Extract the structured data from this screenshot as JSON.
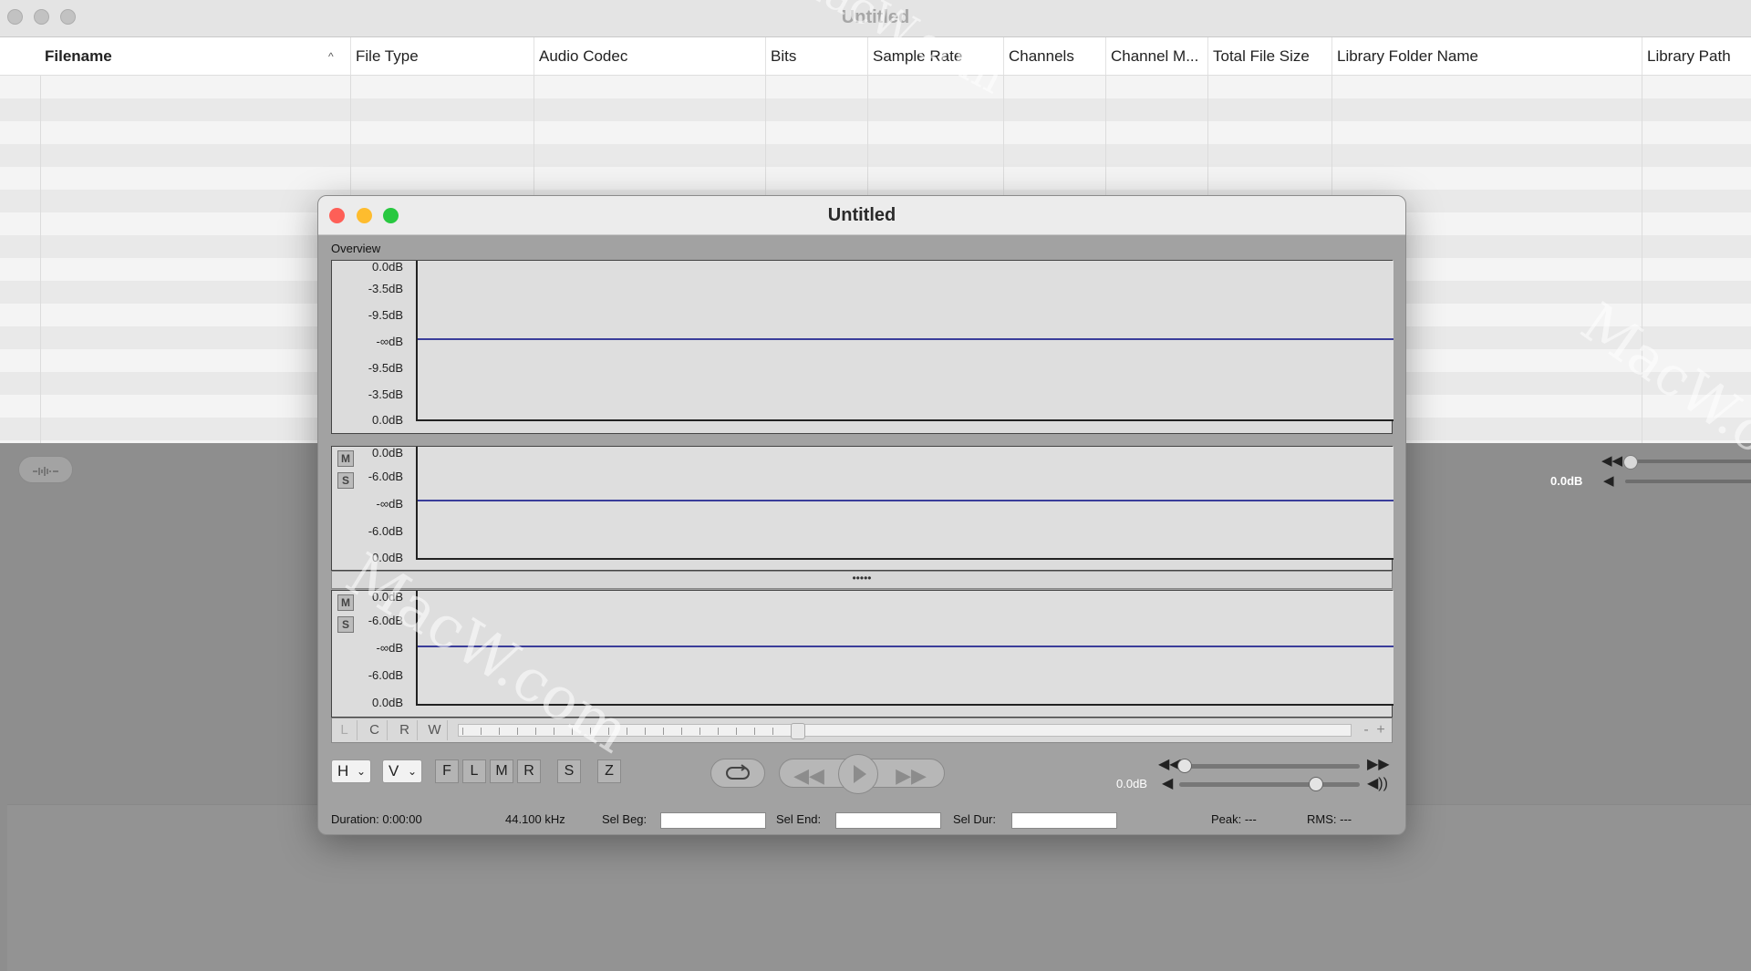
{
  "main_window": {
    "title": "Untitled",
    "columns": [
      "Filename",
      "File Type",
      "Audio Codec",
      "Bits",
      "Sample Rate",
      "Channels",
      "Channel M...",
      "Total File Size",
      "Library Folder Name",
      "Library Path"
    ],
    "sort_indicator": "^",
    "waveform_toggle_icon": "waveform-icon",
    "volume_label": "0.0dB"
  },
  "editor": {
    "title": "Untitled",
    "overview_label": "Overview",
    "overview_axis": [
      "0.0dB",
      "-3.5dB",
      "-9.5dB",
      "-∞dB",
      "-9.5dB",
      "-3.5dB",
      "0.0dB"
    ],
    "channel_axis": [
      "0.0dB",
      "-6.0dB",
      "-∞dB",
      "-6.0dB",
      "0.0dB"
    ],
    "mute_label": "M",
    "solo_label": "S",
    "divider_handle": "•••••",
    "scroll_buttons": [
      "L",
      "C",
      "R",
      "W"
    ],
    "zoom_minus": "-",
    "zoom_plus": "+",
    "dropdown_h": "H",
    "dropdown_v": "V",
    "tool_buttons": [
      "F",
      "L",
      "M",
      "R"
    ],
    "s_button": "S",
    "z_button": "Z",
    "volume_label": "0.0dB",
    "status": {
      "duration": "Duration: 0:00:00",
      "sample_rate": "44.100 kHz",
      "sel_beg_label": "Sel Beg:",
      "sel_end_label": "Sel End:",
      "sel_dur_label": "Sel Dur:",
      "peak": "Peak: ---",
      "rms": "RMS: ---"
    }
  },
  "colors": {
    "close": "#fe5f57",
    "minimize": "#febc2e",
    "zoom": "#28c840",
    "waveform": "#3a3d9a"
  }
}
